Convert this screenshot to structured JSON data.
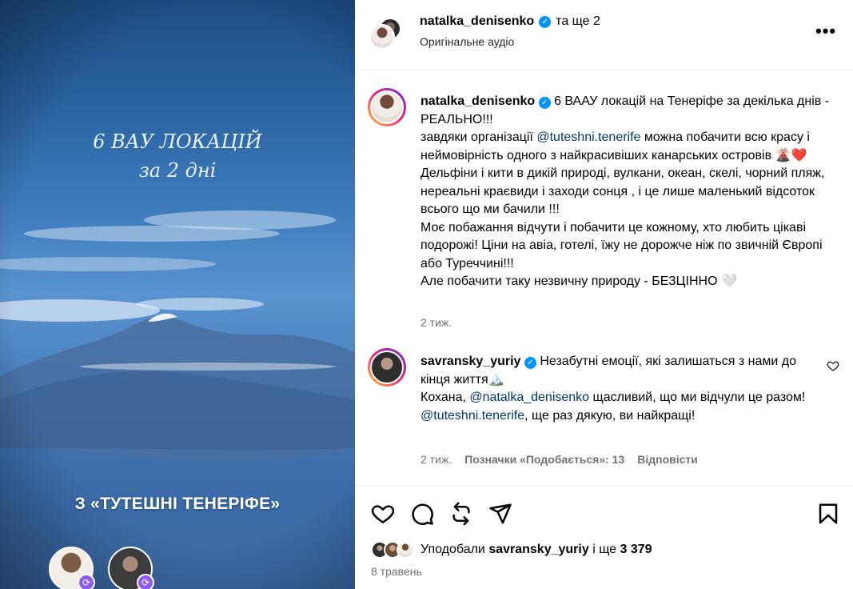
{
  "media": {
    "overlay_title": "6 ВАУ ЛОКАЦІЙ",
    "overlay_subtitle": "за 2 дні",
    "collab_label": "З «ТУТЕШНІ ТЕНЕРІФЕ»"
  },
  "header": {
    "username": "natalka_denisenko",
    "and_others": "та ще 2",
    "audio": "Оригінальне аудіо",
    "menu_icon": "more-dots-icon"
  },
  "caption": {
    "username": "natalka_denisenko",
    "line1": " 6 ВААУ локацій на Тенеріфе за декілька днів - РЕАЛЬНО!!!",
    "line2a": "завдяки організації ",
    "mention": "@tuteshni.tenerife",
    "line2b": " можна побачити всю красу і неймовірність одного з найкрасивіших канарських островів 🌋❤️",
    "line3": "Дельфіни і кити в дикій природі, вулкани, океан, скелі, чорний пляж, нереальні краєвиди і заходи сонця , і це лише маленький відсоток всього що ми бачили !!!",
    "line4": "Моє побажання відчути і побачити це кожному, хто любить цікаві подорожі! Ціни на авіа, готелі, їжу не дорожче ніж по звичній Європі або Туреччині!!!",
    "line5": "Але побачити таку незвичну природу - БЕЗЦІННО 🤍",
    "time": "2 тиж."
  },
  "comment": {
    "username": "savransky_yuriy",
    "text1": " Незабутні емоції, які залишаться з нами до кінця життя🏔️",
    "text2a": "Кохана, ",
    "mention1": "@natalka_denisenko",
    "text2b": " щасливий, що ми відчули це разом!",
    "mention2": "@tuteshni.tenerife",
    "text3": ", ще раз дякую, ви найкращі!",
    "time": "2 тиж.",
    "likes": "Позначки «Подобається»: 13",
    "reply": "Відповісти"
  },
  "actions": {
    "like_icon": "heart-icon",
    "comment_icon": "comment-icon",
    "repost_icon": "repost-icon",
    "share_icon": "send-icon",
    "save_icon": "bookmark-icon"
  },
  "likes": {
    "prefix": "Уподобали ",
    "user": "savransky_yuriy",
    "mid": " і ще ",
    "count": "3 379"
  },
  "date": "8 травень",
  "colors": {
    "verified": "#0095f6",
    "mention": "#00376b",
    "meta": "#737373",
    "collab_badge": "#8c5cf2"
  }
}
